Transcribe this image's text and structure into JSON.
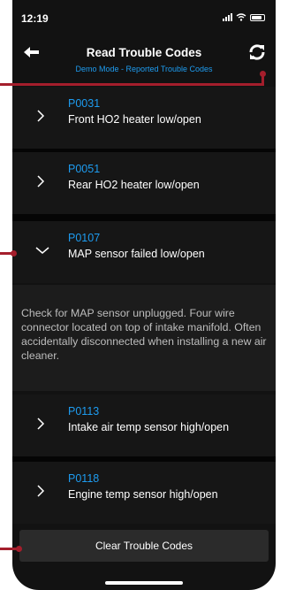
{
  "status_bar": {
    "time": "12:19"
  },
  "header": {
    "title": "Read Trouble Codes",
    "subtitle": "Demo Mode - Reported Trouble Codes"
  },
  "codes": [
    {
      "code": "P0031",
      "description": "Front HO2 heater low/open",
      "expanded": false
    },
    {
      "code": "P0051",
      "description": "Rear HO2 heater low/open",
      "expanded": false
    },
    {
      "code": "P0107",
      "description": "MAP sensor failed low/open",
      "expanded": true
    },
    {
      "code": "P0113",
      "description": "Intake air temp sensor high/open",
      "expanded": false
    },
    {
      "code": "P0118",
      "description": "Engine temp sensor high/open",
      "expanded": false
    }
  ],
  "detail": {
    "text": "Check for MAP sensor unplugged.  Four wire connector located on top of intake manifold. Often accidentally disconnected when installing a new air cleaner."
  },
  "footer": {
    "clear_label": "Clear Trouble Codes"
  },
  "icons": {
    "back": "arrow-left-icon",
    "refresh": "refresh-icon",
    "collapsed": "chevron-right-icon",
    "expanded": "chevron-down-icon"
  },
  "colors": {
    "accent": "#1e9cf0",
    "annotation": "#a41e2c",
    "background": "#121212"
  }
}
